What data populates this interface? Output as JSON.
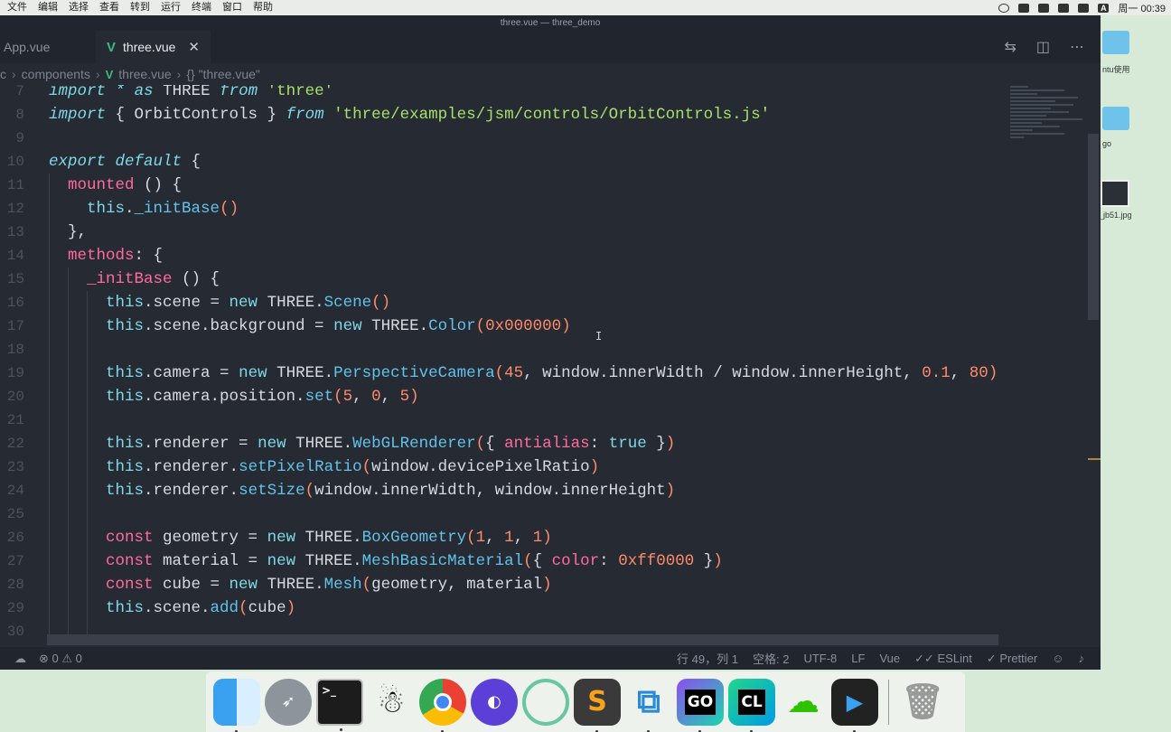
{
  "menubar": {
    "items": [
      "文件",
      "编辑",
      "选择",
      "查看",
      "转到",
      "运行",
      "终端",
      "窗口",
      "帮助"
    ],
    "status_letter": "A",
    "clock": "周一 00:39"
  },
  "desktop": {
    "item1_label": "ntu使用",
    "item2_label": "go",
    "item3_label": "_jb51.jpg"
  },
  "window": {
    "title": "three.vue — three_demo",
    "tabs": [
      {
        "label": "App.vue"
      },
      {
        "label": "three.vue",
        "active": true
      }
    ],
    "breadcrumb": {
      "parts": [
        "c",
        "components",
        "three.vue",
        "{} \"three.vue\""
      ]
    }
  },
  "editor": {
    "lines": [
      {
        "n": "7"
      },
      {
        "n": "8"
      },
      {
        "n": "9"
      },
      {
        "n": "10"
      },
      {
        "n": "11"
      },
      {
        "n": "12"
      },
      {
        "n": "13"
      },
      {
        "n": "14"
      },
      {
        "n": "15"
      },
      {
        "n": "16"
      },
      {
        "n": "17"
      },
      {
        "n": "18"
      },
      {
        "n": "19"
      },
      {
        "n": "20"
      },
      {
        "n": "21"
      },
      {
        "n": "22"
      },
      {
        "n": "23"
      },
      {
        "n": "24"
      },
      {
        "n": "25"
      },
      {
        "n": "26"
      },
      {
        "n": "27"
      },
      {
        "n": "28"
      },
      {
        "n": "29"
      },
      {
        "n": "30"
      }
    ]
  },
  "statusbar": {
    "problems": "⊗ 0 ⚠ 0",
    "position": "行 49，列 1",
    "indent": "空格: 2",
    "encoding": "UTF-8",
    "eol": "LF",
    "language": "Vue",
    "eslint": "✓✓ ESLint",
    "prettier": "✓ Prettier"
  },
  "dock": {
    "apps": [
      "finder-icon",
      "launchpad-icon",
      "terminal-icon",
      "qq-icon",
      "chrome-icon",
      "app-icon",
      "app2-icon",
      "sublime-icon",
      "vscode-icon",
      "goland-icon",
      "clion-icon",
      "wechat-icon",
      "player-icon",
      "trash-icon"
    ],
    "goland_label": "GO",
    "clion_label": "CL"
  },
  "colors": {
    "editor_bg": "#262a33",
    "keyword": "#7fd8e6",
    "pink": "#ff6b9b",
    "number": "#ff8c6b",
    "string": "#a8e06b",
    "method": "#62c2e8"
  }
}
